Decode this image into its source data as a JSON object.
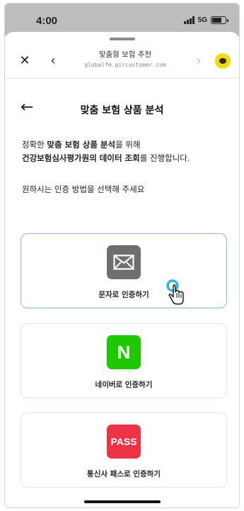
{
  "status_bar": {
    "time": "4:00",
    "network": "5G",
    "battery_level": 0.7
  },
  "browser": {
    "title": "맞춤형 보험 추천",
    "url": "globalfm.gircustomer.com"
  },
  "page": {
    "title": "맞춤 보험 상품 분석",
    "intro": {
      "line1_prefix": "정확한 ",
      "line1_bold": "맞춤 보험 상품 분석",
      "line1_suffix": "을 위해",
      "line2_bold": "건강보험심사평가원의 데이터 조회",
      "line2_suffix": "를 진행합니다."
    },
    "prompt": "원하시는 인증 방법을 선택해 주세요"
  },
  "auth_options": [
    {
      "label": "문자로 인증하기",
      "icon": "envelope-icon",
      "icon_bg": "#6e6e6e",
      "active": true
    },
    {
      "label": "네이버로 인증하기",
      "icon": "naver-icon",
      "icon_text": "N",
      "icon_bg": "#1ec800",
      "active": false
    },
    {
      "label": "통신사 패스로 인증하기",
      "icon": "pass-icon",
      "icon_text": "PASS",
      "icon_bg": "#ec3345",
      "active": false
    }
  ],
  "colors": {
    "active_border": "#8ab8e6",
    "kakao_yellow": "#f5d900"
  }
}
